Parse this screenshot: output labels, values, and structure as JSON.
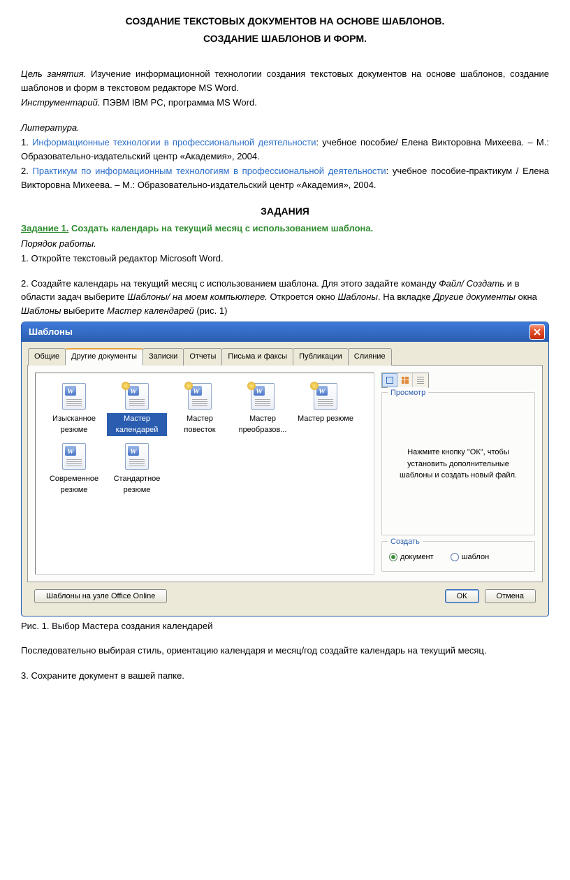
{
  "title_line1": "СОЗДАНИЕ ТЕКСТОВЫХ ДОКУМЕНТОВ НА ОСНОВЕ ШАБЛОНОВ.",
  "title_line2": "СОЗДАНИЕ ШАБЛОНОВ И ФОРМ.",
  "goal_label": "Цель занятия.",
  "goal_text": " Изучение информационной технологии создания текстовых документов на основе шаблонов, создание шаблонов и форм в текстовом редакторе MS Word.",
  "tools_label": "Инструментарий.",
  "tools_text": " ПЭВМ IBM PC, программа MS Word.",
  "lit_label": "Литература.",
  "lit1_num": "1. ",
  "lit1_link": "Информационные технологии в профессиональной деятельности",
  "lit1_rest": ": учебное пособие/ Елена Викторовна Михеева. – М.: Образовательно-издательский центр «Академия», 2004.",
  "lit2_num": "2. ",
  "lit2_link": "Практикум по информационным технологиям в профессиональной деятельности",
  "lit2_rest": ": учебное пособие-практикум / Елена Викторовна Михеева. – М.: Образовательно-издательский центр «Академия», 2004.",
  "tasks_header": "ЗАДАНИЯ",
  "task1_num": "Задание 1.",
  "task1_title": " Создать календарь на текущий месяц с использованием шаблона.",
  "order_label": "Порядок работы.",
  "step1": "1. Откройте текстовый редактор Microsoft Word.",
  "step2a": "2. Создайте календарь на текущий месяц с использованием шаблона. Для этого задайте команду ",
  "step2b": "Файл/ Создать",
  "step2c": " и в области задач выберите ",
  "step2d": "Шаблоны/ на моем компьютере.",
  "step2e": " Откроется окно ",
  "step2f": "Шаблоны",
  "step2g": ". На вкладке ",
  "step2h": "Другие документы",
  "step2i": " окна ",
  "step2j": "Шаблоны",
  "step2k": " выберите ",
  "step2l": "Мастер календарей",
  "step2m": " (рис. 1)",
  "dialog": {
    "title": "Шаблоны",
    "tabs": [
      "Общие",
      "Другие документы",
      "Записки",
      "Отчеты",
      "Письма и факсы",
      "Публикации",
      "Слияние"
    ],
    "active_tab": 1,
    "items": [
      {
        "label": "Изысканное резюме",
        "wizard": false
      },
      {
        "label": "Мастер календарей",
        "wizard": true,
        "selected": true
      },
      {
        "label": "Мастер повесток",
        "wizard": true
      },
      {
        "label": "Мастер преобразов...",
        "wizard": true
      },
      {
        "label": "Мастер резюме",
        "wizard": true
      },
      {
        "label": "Современное резюме",
        "wizard": false
      },
      {
        "label": "Стандартное резюме",
        "wizard": false
      }
    ],
    "preview_group": "Просмотр",
    "preview_text": "Нажмите кнопку \"ОК\", чтобы установить дополнительные шаблоны и создать новый файл.",
    "create_group": "Создать",
    "radio_doc": "документ",
    "radio_tpl": "шаблон",
    "office_online": "Шаблоны на узле Office Online",
    "ok": "ОК",
    "cancel": "Отмена"
  },
  "fig_caption": "Рис. 1. Выбор Мастера создания календарей",
  "after1": "Последовательно выбирая стиль, ориентацию календаря и месяц/год создайте календарь на текущий месяц.",
  "step3": "3. Сохраните документ в вашей папке."
}
